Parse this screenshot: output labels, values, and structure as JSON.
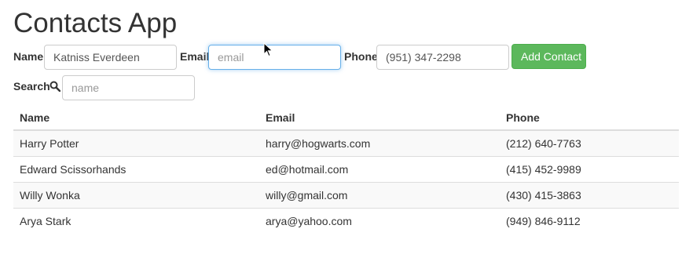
{
  "title": "Contacts App",
  "form": {
    "name_label": "Name",
    "name_value": "Katniss Everdeen",
    "email_label": "Email",
    "email_placeholder": "email",
    "phone_label": "Phone",
    "phone_value": "(951) 347-2298",
    "add_button": "Add Contact"
  },
  "search": {
    "label": "Search",
    "icon": "search-icon",
    "placeholder": "name"
  },
  "table": {
    "headers": [
      "Name",
      "Email",
      "Phone"
    ],
    "rows": [
      [
        "Harry Potter",
        "harry@hogwarts.com",
        "(212) 640-7763"
      ],
      [
        "Edward Scissorhands",
        "ed@hotmail.com",
        "(415) 452-9989"
      ],
      [
        "Willy Wonka",
        "willy@gmail.com",
        "(430) 415-3863"
      ],
      [
        "Arya Stark",
        "arya@yahoo.com",
        "(949) 846-9112"
      ]
    ]
  },
  "colors": {
    "button_bg": "#5cb85c",
    "focus_border": "#66afe9",
    "stripe": "#f9f9f9"
  }
}
